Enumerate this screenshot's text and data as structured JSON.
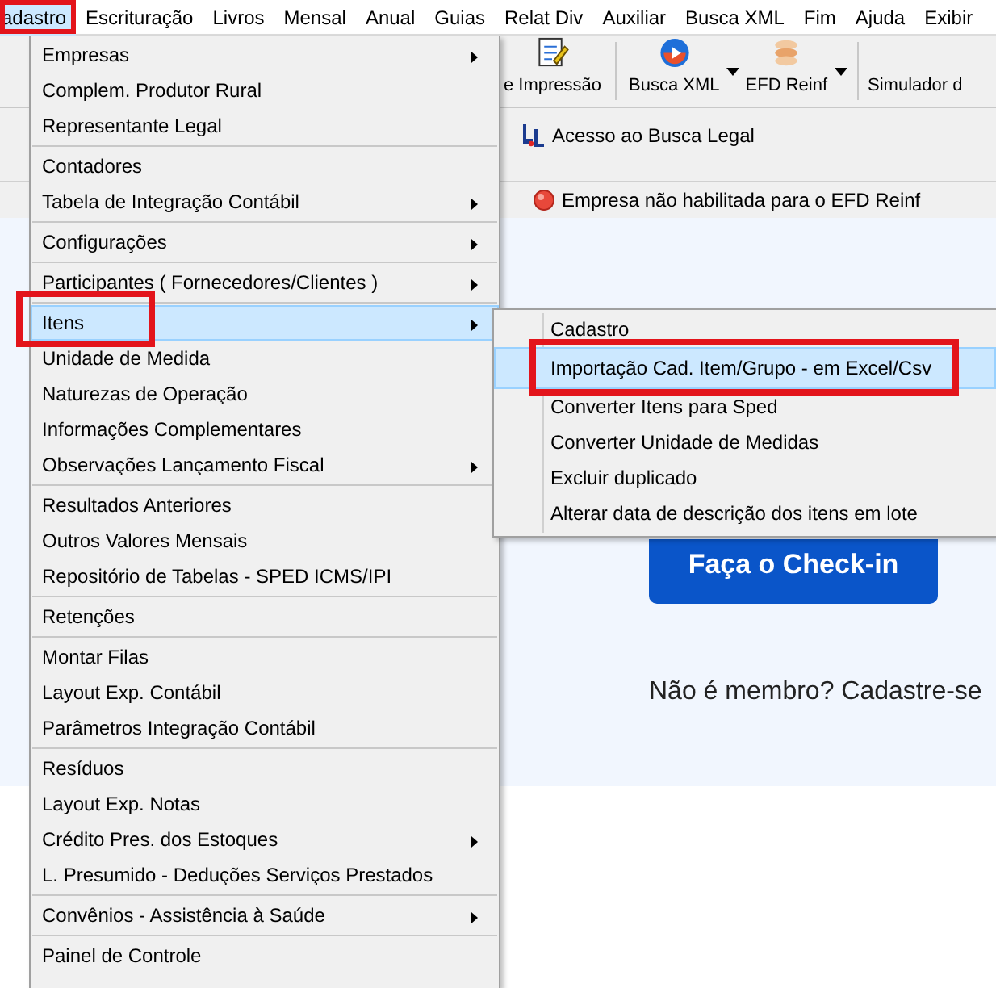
{
  "menu_bar": [
    {
      "label": "adastro",
      "selected": true,
      "annotated": true
    },
    {
      "label": "Escrituração",
      "selected": false,
      "annotated": false
    },
    {
      "label": "Livros",
      "selected": false,
      "annotated": false
    },
    {
      "label": "Mensal",
      "selected": false,
      "annotated": false
    },
    {
      "label": "Anual",
      "selected": false,
      "annotated": false
    },
    {
      "label": "Guias",
      "selected": false,
      "annotated": false
    },
    {
      "label": "Relat Div",
      "selected": false,
      "annotated": false
    },
    {
      "label": "Auxiliar",
      "selected": false,
      "annotated": false
    },
    {
      "label": "Busca XML",
      "selected": false,
      "annotated": false
    },
    {
      "label": "Fim",
      "selected": false,
      "annotated": false
    },
    {
      "label": "Ajuda",
      "selected": false,
      "annotated": false
    },
    {
      "label": "Exibir",
      "selected": false,
      "annotated": false
    }
  ],
  "toolbar": [
    {
      "label": "e Impressão",
      "kind": "button"
    },
    {
      "label": "Busca XML",
      "kind": "split"
    },
    {
      "label": "EFD Reinf",
      "kind": "split"
    },
    {
      "label": "Simulador d",
      "kind": "button"
    }
  ],
  "link": {
    "label": "Acesso ao Busca Legal"
  },
  "status": {
    "text": "Empresa não habilitada para o EFD Reinf"
  },
  "login": {
    "button": "Faça o Check-in",
    "signup": "Não é membro? Cadastre-se"
  },
  "menu": [
    [
      {
        "label": "Empresas",
        "submenu": true,
        "selected": false,
        "annotated": false
      },
      {
        "label": "Complem. Produtor Rural",
        "submenu": false,
        "selected": false,
        "annotated": false
      },
      {
        "label": "Representante Legal",
        "submenu": false,
        "selected": false,
        "annotated": false
      }
    ],
    [
      {
        "label": "Contadores",
        "submenu": false,
        "selected": false,
        "annotated": false
      },
      {
        "label": "Tabela de Integração Contábil",
        "submenu": true,
        "selected": false,
        "annotated": false
      }
    ],
    [
      {
        "label": "Configurações",
        "submenu": true,
        "selected": false,
        "annotated": false
      }
    ],
    [
      {
        "label": "Participantes ( Fornecedores/Clientes )",
        "submenu": true,
        "selected": false,
        "annotated": false
      }
    ],
    [
      {
        "label": "Itens",
        "submenu": true,
        "selected": true,
        "annotated": true
      },
      {
        "label": "Unidade de Medida",
        "submenu": false,
        "selected": false,
        "annotated": false
      },
      {
        "label": "Naturezas de Operação",
        "submenu": false,
        "selected": false,
        "annotated": false
      },
      {
        "label": "Informações Complementares",
        "submenu": false,
        "selected": false,
        "annotated": false
      },
      {
        "label": "Observações Lançamento Fiscal",
        "submenu": true,
        "selected": false,
        "annotated": false
      }
    ],
    [
      {
        "label": "Resultados Anteriores",
        "submenu": false,
        "selected": false,
        "annotated": false
      },
      {
        "label": "Outros Valores Mensais",
        "submenu": false,
        "selected": false,
        "annotated": false
      },
      {
        "label": "Repositório de Tabelas - SPED ICMS/IPI",
        "submenu": false,
        "selected": false,
        "annotated": false
      }
    ],
    [
      {
        "label": "Retenções",
        "submenu": false,
        "selected": false,
        "annotated": false
      }
    ],
    [
      {
        "label": "Montar Filas",
        "submenu": false,
        "selected": false,
        "annotated": false
      },
      {
        "label": "Layout Exp. Contábil",
        "submenu": false,
        "selected": false,
        "annotated": false
      },
      {
        "label": "Parâmetros Integração Contábil",
        "submenu": false,
        "selected": false,
        "annotated": false
      }
    ],
    [
      {
        "label": "Resíduos",
        "submenu": false,
        "selected": false,
        "annotated": false
      },
      {
        "label": "Layout Exp. Notas",
        "submenu": false,
        "selected": false,
        "annotated": false
      },
      {
        "label": "Crédito Pres. dos Estoques",
        "submenu": true,
        "selected": false,
        "annotated": false
      },
      {
        "label": "L. Presumido - Deduções Serviços Prestados",
        "submenu": false,
        "selected": false,
        "annotated": false
      }
    ],
    [
      {
        "label": "Convênios - Assistência à Saúde",
        "submenu": true,
        "selected": false,
        "annotated": false
      }
    ],
    [
      {
        "label": "Painel de Controle",
        "submenu": false,
        "selected": false,
        "annotated": false
      }
    ]
  ],
  "submenu": [
    {
      "label": "Cadastro",
      "selected": false,
      "annotated": false
    },
    {
      "label": "Importação Cad. Item/Grupo - em Excel/Csv",
      "selected": true,
      "annotated": true
    },
    {
      "label": "Converter Itens para Sped",
      "selected": false,
      "annotated": false
    },
    {
      "label": "Converter Unidade de Medidas",
      "selected": false,
      "annotated": false
    },
    {
      "label": "Excluir duplicado",
      "selected": false,
      "annotated": false
    },
    {
      "label": "Alterar data de descrição dos itens em lote",
      "selected": false,
      "annotated": false
    }
  ]
}
